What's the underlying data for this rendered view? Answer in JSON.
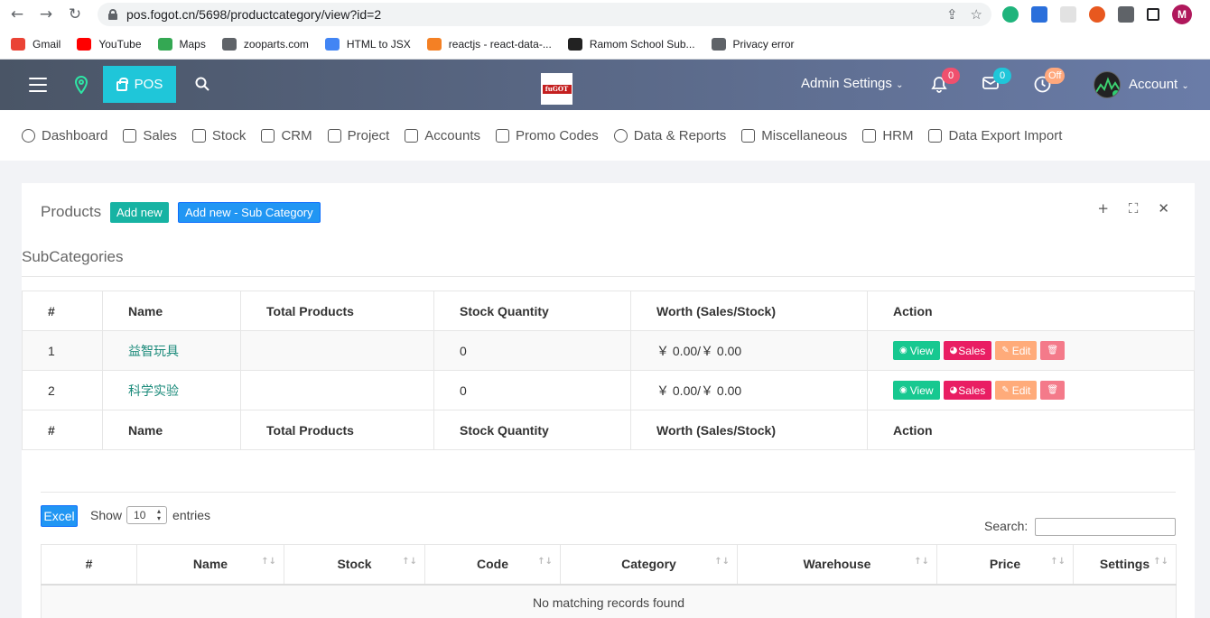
{
  "browser": {
    "url": "pos.fogot.cn/5698/productcategory/view?id=2",
    "profile_initial": "M",
    "bookmarks": [
      {
        "label": "Gmail",
        "color": "#ea4335"
      },
      {
        "label": "YouTube",
        "color": "#ff0000"
      },
      {
        "label": "Maps",
        "color": "#34a853"
      },
      {
        "label": "zooparts.com",
        "color": "#5f6368"
      },
      {
        "label": "HTML to JSX",
        "color": "#4285f4"
      },
      {
        "label": "reactjs - react-data-...",
        "color": "#f48024"
      },
      {
        "label": "Ramom School Sub...",
        "color": "#222222"
      },
      {
        "label": "Privacy error",
        "color": "#5f6368"
      }
    ]
  },
  "header": {
    "pos_label": "POS",
    "admin_settings": "Admin Settings",
    "notifications_count": "0",
    "messages_count": "0",
    "clock_status": "Off",
    "account_label": "Account",
    "logo_text": "fuGOT"
  },
  "menu": [
    {
      "label": "Dashboard",
      "icon": "dashboard-icon"
    },
    {
      "label": "Sales",
      "icon": "cart-icon"
    },
    {
      "label": "Stock",
      "icon": "layers-icon"
    },
    {
      "label": "CRM",
      "icon": "diamond-icon"
    },
    {
      "label": "Project",
      "icon": "briefcase-icon"
    },
    {
      "label": "Accounts",
      "icon": "calculator-icon"
    },
    {
      "label": "Promo Codes",
      "icon": "bolt-icon"
    },
    {
      "label": "Data & Reports",
      "icon": "pie-icon"
    },
    {
      "label": "Miscellaneous",
      "icon": "edit-icon"
    },
    {
      "label": "HRM",
      "icon": "document-icon"
    },
    {
      "label": "Data Export Import",
      "icon": "bar-chart-icon"
    }
  ],
  "card": {
    "title": "Products",
    "add_new": "Add new",
    "add_sub": "Add new - Sub Category",
    "subtitle": "SubCategories"
  },
  "subtable": {
    "headers": [
      "#",
      "Name",
      "Total Products",
      "Stock Quantity",
      "Worth (Sales/Stock)",
      "Action"
    ],
    "rows": [
      {
        "num": "1",
        "name": "益智玩具",
        "total": "",
        "stock": "0",
        "worth": "￥ 0.00/￥ 0.00"
      },
      {
        "num": "2",
        "name": "科学实验",
        "total": "",
        "stock": "0",
        "worth": "￥ 0.00/￥ 0.00"
      }
    ],
    "actions": {
      "view": "View",
      "sales": "Sales",
      "edit": "Edit"
    }
  },
  "datatable": {
    "excel": "Excel",
    "show": "Show",
    "entries_value": "10",
    "entries": "entries",
    "search": "Search:",
    "headers": [
      "#",
      "Name",
      "Stock",
      "Code",
      "Category",
      "Warehouse",
      "Price",
      "Settings"
    ],
    "empty": "No matching records found"
  }
}
